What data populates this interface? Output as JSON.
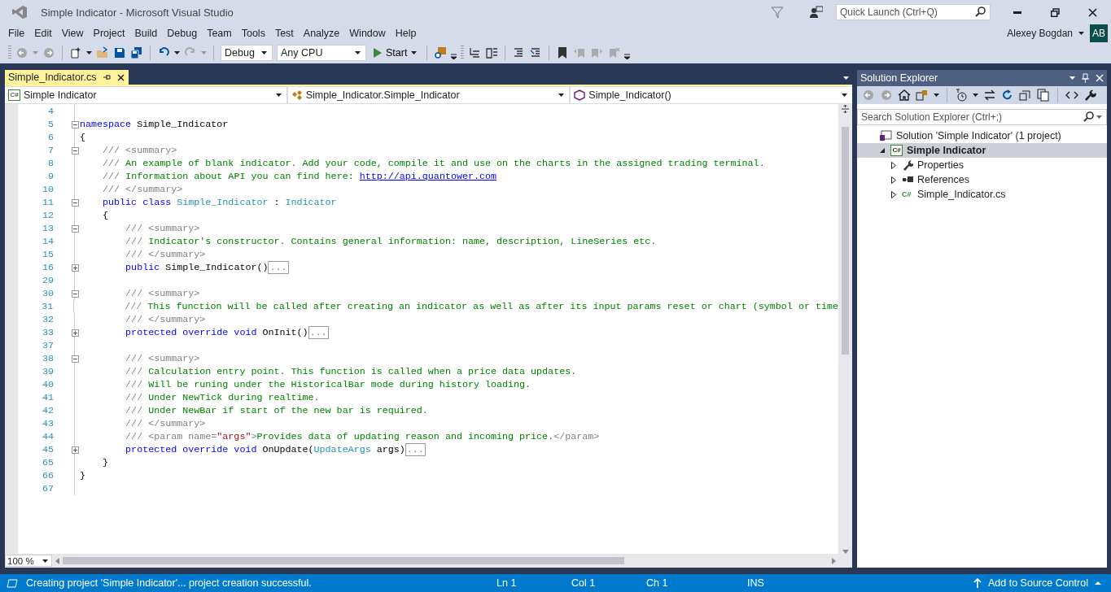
{
  "window": {
    "title": "Simple Indicator - Microsoft Visual Studio",
    "quick_launch": {
      "placeholder": "Quick Launch (Ctrl+Q)"
    }
  },
  "menu": [
    "File",
    "Edit",
    "View",
    "Project",
    "Build",
    "Debug",
    "Team",
    "Tools",
    "Test",
    "Analyze",
    "Window",
    "Help"
  ],
  "account": {
    "name": "Alexey Bogdan",
    "initials": "AB"
  },
  "toolbar": {
    "configuration": "Debug",
    "platform": "Any CPU",
    "start": "Start"
  },
  "editor": {
    "tabs": [
      {
        "label": "Simple_Indicator.cs",
        "selected": true
      }
    ],
    "nav": [
      {
        "kind": "project",
        "badge": "C#",
        "label": "Simple Indicator"
      },
      {
        "kind": "class",
        "label": "Simple_Indicator.Simple_Indicator"
      },
      {
        "kind": "method",
        "label": "Simple_Indicator()"
      }
    ],
    "lines": [
      {
        "number": "4"
      },
      {
        "number": "5",
        "collapsed": false,
        "tokens": [
          {
            "kind": "keyword",
            "t": "namespace"
          },
          {
            "kind": "plain",
            "t": " Simple_Indicator"
          }
        ]
      },
      {
        "number": "6",
        "tokens": [
          {
            "kind": "plain",
            "t": "{"
          }
        ]
      },
      {
        "number": "7",
        "collapsed": false,
        "tokens": [
          {
            "kind": "doc",
            "t": "    /// <summary>"
          }
        ]
      },
      {
        "number": "8",
        "tokens": [
          {
            "kind": "doc",
            "t": "    ///"
          },
          {
            "kind": "comment",
            "t": " An example of blank indicator. Add your code, compile it and use on the charts in the assigned trading terminal."
          }
        ]
      },
      {
        "number": "9",
        "tokens": [
          {
            "kind": "doc",
            "t": "    ///"
          },
          {
            "kind": "comment",
            "t": " Information about API you can find here: "
          },
          {
            "kind": "link",
            "t": "http://api.quantower.com"
          }
        ]
      },
      {
        "number": "10",
        "tokens": [
          {
            "kind": "doc",
            "t": "    /// </summary>"
          }
        ]
      },
      {
        "number": "11",
        "collapsed": false,
        "tokens": [
          {
            "kind": "keyword",
            "t": "    public class"
          },
          {
            "kind": "type",
            "t": " Simple_Indicator"
          },
          {
            "kind": "plain",
            "t": " : "
          },
          {
            "kind": "type",
            "t": "Indicator"
          }
        ]
      },
      {
        "number": "12",
        "tokens": [
          {
            "kind": "plain",
            "t": "    {"
          }
        ]
      },
      {
        "number": "13",
        "collapsed": false,
        "tokens": [
          {
            "kind": "doc",
            "t": "        /// <summary>"
          }
        ]
      },
      {
        "number": "14",
        "tokens": [
          {
            "kind": "doc",
            "t": "        ///"
          },
          {
            "kind": "comment",
            "t": " Indicator's constructor. Contains general information: name, description, LineSeries etc."
          }
        ]
      },
      {
        "number": "15",
        "tokens": [
          {
            "kind": "doc",
            "t": "        /// </summary>"
          }
        ]
      },
      {
        "number": "16",
        "collapsed": true,
        "tokens": [
          {
            "kind": "keyword",
            "t": "        public"
          },
          {
            "kind": "plain",
            "t": " Simple_Indicator()"
          },
          {
            "kind": "collapsed",
            "t": "..."
          }
        ]
      },
      {
        "number": "29"
      },
      {
        "number": "30",
        "collapsed": false,
        "tokens": [
          {
            "kind": "doc",
            "t": "        /// <summary>"
          }
        ]
      },
      {
        "number": "31",
        "tokens": [
          {
            "kind": "doc",
            "t": "        ///"
          },
          {
            "kind": "comment",
            "t": " This function will be called after creating an indicator as well as after its input params reset or chart (symbol or time"
          }
        ]
      },
      {
        "number": "32",
        "tokens": [
          {
            "kind": "doc",
            "t": "        /// </summary>"
          }
        ]
      },
      {
        "number": "33",
        "collapsed": true,
        "tokens": [
          {
            "kind": "keyword",
            "t": "        protected override void"
          },
          {
            "kind": "plain",
            "t": " OnInit()"
          },
          {
            "kind": "collapsed",
            "t": "..."
          }
        ]
      },
      {
        "number": "37"
      },
      {
        "number": "38",
        "collapsed": false,
        "tokens": [
          {
            "kind": "doc",
            "t": "        /// <summary>"
          }
        ]
      },
      {
        "number": "39",
        "tokens": [
          {
            "kind": "doc",
            "t": "        ///"
          },
          {
            "kind": "comment",
            "t": " Calculation entry point. This function is called when a price data updates."
          }
        ]
      },
      {
        "number": "40",
        "tokens": [
          {
            "kind": "doc",
            "t": "        ///"
          },
          {
            "kind": "comment",
            "t": " Will be runing under the HistoricalBar mode during history loading."
          }
        ]
      },
      {
        "number": "41",
        "tokens": [
          {
            "kind": "doc",
            "t": "        ///"
          },
          {
            "kind": "comment",
            "t": " Under NewTick during realtime."
          }
        ]
      },
      {
        "number": "42",
        "tokens": [
          {
            "kind": "doc",
            "t": "        ///"
          },
          {
            "kind": "comment",
            "t": " Under NewBar if start of the new bar is required."
          }
        ]
      },
      {
        "number": "43",
        "tokens": [
          {
            "kind": "doc",
            "t": "        /// </summary>"
          }
        ]
      },
      {
        "number": "44",
        "tokens": [
          {
            "kind": "doc",
            "t": "        /// <param name="
          },
          {
            "kind": "string",
            "t": "\"args\""
          },
          {
            "kind": "doc",
            "t": ">"
          },
          {
            "kind": "comment",
            "t": "Provides data of updating reason and incoming price."
          },
          {
            "kind": "doc",
            "t": "</param>"
          }
        ]
      },
      {
        "number": "45",
        "collapsed": true,
        "tokens": [
          {
            "kind": "keyword",
            "t": "        protected override void"
          },
          {
            "kind": "plain",
            "t": " OnUpdate("
          },
          {
            "kind": "type",
            "t": "UpdateArgs"
          },
          {
            "kind": "plain",
            "t": " args)"
          },
          {
            "kind": "collapsed",
            "t": "..."
          }
        ]
      },
      {
        "number": "65",
        "tokens": [
          {
            "kind": "plain",
            "t": "    }"
          }
        ]
      },
      {
        "number": "66",
        "tokens": [
          {
            "kind": "plain",
            "t": "}"
          }
        ]
      },
      {
        "number": "67"
      }
    ],
    "zoom": "100 %"
  },
  "solution_explorer": {
    "title": "Solution Explorer",
    "search": {
      "placeholder": "Search Solution Explorer (Ctrl+;)"
    },
    "tree": [
      {
        "kind": "solution",
        "label": "Solution 'Simple Indicator' (1 project)",
        "children": [
          {
            "kind": "project",
            "badge": "C#",
            "label": "Simple Indicator",
            "selected": true,
            "expanded": true,
            "children": [
              {
                "kind": "properties",
                "label": "Properties",
                "selected": false,
                "expanded": false
              },
              {
                "kind": "references",
                "label": "References",
                "selected": false,
                "expanded": false
              },
              {
                "kind": "file",
                "badge": "C#",
                "label": "Simple_Indicator.cs",
                "selected": false,
                "expanded": false
              }
            ]
          }
        ]
      }
    ]
  },
  "status_bar": {
    "message": "Creating project 'Simple Indicator'... project creation successful.",
    "ln": "Ln 1",
    "col": "Col 1",
    "ch": "Ch 1",
    "mode": "INS",
    "source_control": "Add to Source Control"
  }
}
